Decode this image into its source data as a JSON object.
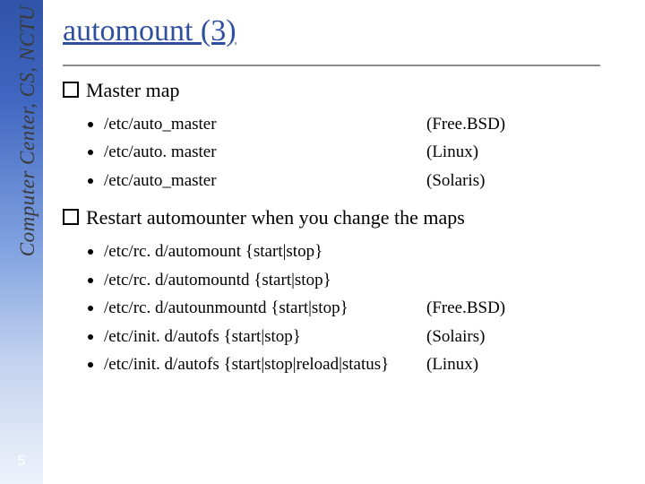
{
  "institute": "Computer Center, CS, NCTU",
  "page_number": "5",
  "title": "automount (3)",
  "sections": [
    {
      "heading": "Master map",
      "items": [
        {
          "text": "/etc/auto_master",
          "os": "(Free.BSD)"
        },
        {
          "text": "/etc/auto. master",
          "os": "(Linux)"
        },
        {
          "text": "/etc/auto_master",
          "os": "(Solaris)"
        }
      ]
    },
    {
      "heading": "Restart automounter when you change the maps",
      "items": [
        {
          "text": "/etc/rc. d/automount {start|stop}",
          "os": ""
        },
        {
          "text": "/etc/rc. d/automountd {start|stop}",
          "os": ""
        },
        {
          "text": "/etc/rc. d/autounmountd {start|stop}",
          "os": "(Free.BSD)"
        },
        {
          "text": "/etc/init. d/autofs {start|stop}",
          "os": "(Solairs)"
        },
        {
          "text": "/etc/init. d/autofs {start|stop|reload|status}",
          "os": "(Linux)"
        }
      ]
    }
  ]
}
